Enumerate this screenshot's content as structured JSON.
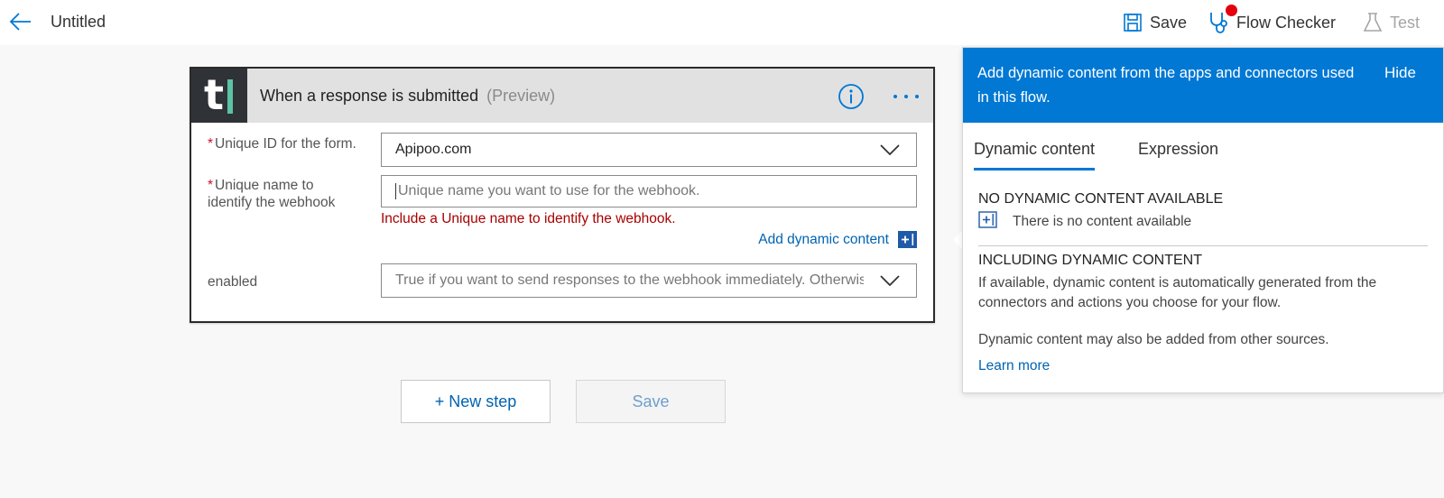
{
  "header": {
    "title": "Untitled",
    "save_label": "Save",
    "flow_checker_label": "Flow Checker",
    "test_label": "Test"
  },
  "trigger": {
    "logo_text": "t",
    "title": "When a response is submitted",
    "preview": "(Preview)",
    "fields": [
      {
        "label": "Unique ID for the form.",
        "required": "*",
        "value": "Apipoo.com"
      },
      {
        "label": "Unique name to identify the webhook",
        "required": "*",
        "placeholder": "Unique name you want to use for the webhook.",
        "error": "Include a Unique name to identify the webhook."
      },
      {
        "label": "enabled",
        "placeholder": "True if you want to send responses to the webhook immediately. Otherwise, false."
      }
    ],
    "add_dynamic_label": "Add dynamic content"
  },
  "steps": {
    "new_step_label": "+ New step",
    "save_label": "Save"
  },
  "panel": {
    "message": "Add dynamic content from the apps and connectors used in this flow.",
    "hide_label": "Hide",
    "tabs": [
      "Dynamic content",
      "Expression"
    ],
    "no_content_heading": "NO DYNAMIC CONTENT AVAILABLE",
    "no_content_text": "There is no content available",
    "including_heading": "INCLUDING DYNAMIC CONTENT",
    "including_text": "If available, dynamic content is automatically generated from the connectors and actions you choose for your flow.",
    "other_sources_text": "Dynamic content may also be added from other sources.",
    "learn_more": "Learn more"
  },
  "colors": {
    "accent": "#0078d4",
    "link": "#0063b1",
    "error": "#a80000",
    "logo_bg": "#2f3236",
    "logo_bar": "#5bc2a7"
  }
}
